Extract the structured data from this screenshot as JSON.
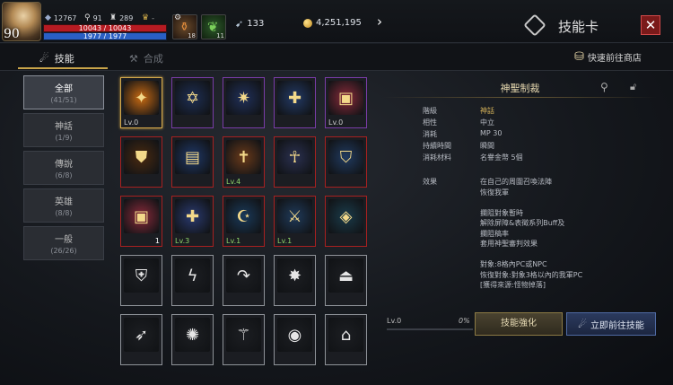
{
  "hud": {
    "level": "90",
    "stat1": "12767",
    "stat2": "91",
    "stat3": "289",
    "hp_text": "10043 / 10043",
    "mp_text": "1977 / 1977",
    "buff1_count": "18",
    "buff2_count": "11",
    "gem_count": "133",
    "gold_count": "4,251,195"
  },
  "window": {
    "title": "技能卡",
    "close_label": "✕"
  },
  "tabs": [
    {
      "label": "技能"
    },
    {
      "label": "合成"
    }
  ],
  "shop_label": "快速前往商店",
  "categories": [
    {
      "name": "全部",
      "count": "(41/51)"
    },
    {
      "name": "神話",
      "count": "(1/9)"
    },
    {
      "name": "傳說",
      "count": "(6/8)"
    },
    {
      "name": "英雄",
      "count": "(8/8)"
    },
    {
      "name": "一般",
      "count": "(26/26)"
    }
  ],
  "cells": [
    {
      "lv": "Lv.0",
      "badge": "",
      "rarity": "gold",
      "glyph": "✦",
      "bg": "#c86a12"
    },
    {
      "lv": "",
      "badge": "",
      "rarity": "purple",
      "glyph": "✡",
      "bg": "#1e2f55"
    },
    {
      "lv": "",
      "badge": "",
      "rarity": "purple",
      "glyph": "✷",
      "bg": "#20305a"
    },
    {
      "lv": "",
      "badge": "",
      "rarity": "purple",
      "glyph": "✚",
      "bg": "#233a66"
    },
    {
      "lv": "Lv.0",
      "badge": "",
      "rarity": "purple",
      "glyph": "▣",
      "bg": "#8a2a3a"
    },
    {
      "lv": "",
      "badge": "",
      "rarity": "red",
      "glyph": "⛊",
      "bg": "#4a2a10"
    },
    {
      "lv": "",
      "badge": "",
      "rarity": "red",
      "glyph": "▤",
      "bg": "#1f3868"
    },
    {
      "lv": "Lv.4",
      "badge": "",
      "rarity": "red",
      "glyph": "✝",
      "bg": "#6a3a1a",
      "green": true
    },
    {
      "lv": "",
      "badge": "",
      "rarity": "red",
      "glyph": "☥",
      "bg": "#2a3050"
    },
    {
      "lv": "",
      "badge": "",
      "rarity": "red",
      "glyph": "⛉",
      "bg": "#203a60"
    },
    {
      "lv": "",
      "badge": "1",
      "rarity": "red",
      "glyph": "▣",
      "bg": "#8a2a3a"
    },
    {
      "lv": "Lv.3",
      "badge": "",
      "rarity": "red",
      "glyph": "✚",
      "bg": "#2a3a70",
      "green": true
    },
    {
      "lv": "Lv.1",
      "badge": "",
      "rarity": "red",
      "glyph": "☪",
      "bg": "#1a3a5a",
      "green": true
    },
    {
      "lv": "Lv.1",
      "badge": "",
      "rarity": "red",
      "glyph": "⚔",
      "bg": "#1f3a5a",
      "green": true
    },
    {
      "lv": "",
      "badge": "",
      "rarity": "red",
      "glyph": "◈",
      "bg": "#1a3b4a"
    },
    {
      "lv": "",
      "badge": "",
      "rarity": "white",
      "glyph": "⛨",
      "bg": "#1c1e22"
    },
    {
      "lv": "",
      "badge": "",
      "rarity": "white",
      "glyph": "ϟ",
      "bg": "#1c1e22"
    },
    {
      "lv": "",
      "badge": "",
      "rarity": "white",
      "glyph": "↷",
      "bg": "#1c1e22"
    },
    {
      "lv": "",
      "badge": "",
      "rarity": "white",
      "glyph": "✸",
      "bg": "#1c1e22"
    },
    {
      "lv": "",
      "badge": "",
      "rarity": "white",
      "glyph": "⏏",
      "bg": "#1c1e22"
    },
    {
      "lv": "",
      "badge": "",
      "rarity": "white",
      "glyph": "➶",
      "bg": "#1c1e22"
    },
    {
      "lv": "",
      "badge": "",
      "rarity": "white",
      "glyph": "✺",
      "bg": "#1c1e22"
    },
    {
      "lv": "",
      "badge": "",
      "rarity": "white",
      "glyph": "⚚",
      "bg": "#1c1e22"
    },
    {
      "lv": "",
      "badge": "",
      "rarity": "white",
      "glyph": "◉",
      "bg": "#1c1e22"
    },
    {
      "lv": "",
      "badge": "",
      "rarity": "white",
      "glyph": "⌂",
      "bg": "#1c1e22"
    }
  ],
  "detail": {
    "name": "神聖制裁",
    "rows": [
      {
        "label": "階級",
        "value": "神話",
        "gold": true
      },
      {
        "label": "相性",
        "value": "中立"
      },
      {
        "label": "消耗",
        "value": "MP 30"
      },
      {
        "label": "持續時間",
        "value": "瞬間"
      },
      {
        "label": "消耗材料",
        "value": "名譽金幣 5個"
      }
    ],
    "effect_label": "效果",
    "effect_lines": [
      "在自己的周圍召喚法陣",
      "恢復我軍",
      "",
      "攔阻對象暫時",
      "解除屏障&表徵系列Buff及",
      "攔阻稿率",
      "套用神聖審判效果",
      "",
      "對象:8格內PC或NPC",
      "恢復對象:對象3格以內的我軍PC",
      "[獲得來源:怪物掉落]"
    ]
  },
  "bottom": {
    "lv": "Lv.0",
    "pct": "0%",
    "enhance": "技能強化",
    "goto": "立即前往技能"
  }
}
